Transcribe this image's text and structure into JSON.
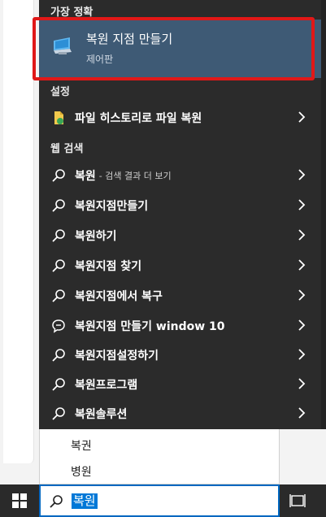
{
  "sections": {
    "best_match_header": "가장 정확",
    "settings_header": "설정",
    "web_header": "웹 검색"
  },
  "best_match": {
    "title": "복원 지점 만들기",
    "subtitle": "제어판",
    "icon": "system-restore-monitor-icon"
  },
  "settings_items": [
    {
      "label": "파일 히스토리로 파일 복원",
      "icon": "file-history-icon"
    }
  ],
  "web_items": [
    {
      "label": "복원",
      "suffix": "- 검색 결과 더 보기",
      "icon": "search-icon"
    },
    {
      "label": "복원지점만들기",
      "icon": "search-icon"
    },
    {
      "label": "복원하기",
      "icon": "search-icon"
    },
    {
      "label": "복원지점 찾기",
      "icon": "search-icon"
    },
    {
      "label": "복원지점에서 복구",
      "icon": "search-icon"
    },
    {
      "label": "복원지점 만들기 window 10",
      "icon": "chat-bubble-icon"
    },
    {
      "label": "복원지점설정하기",
      "icon": "search-icon"
    },
    {
      "label": "복원프로그램",
      "icon": "search-icon"
    },
    {
      "label": "복원솔루션",
      "icon": "search-icon"
    }
  ],
  "suggestions": [
    "복권",
    "병원"
  ],
  "search": {
    "value": "복원"
  },
  "colors": {
    "panel_bg": "#2b2b2b",
    "best_match_bg": "#3e5a75",
    "highlight": "#e01818",
    "taskbar": "#2a2a2a",
    "accent": "#0078d7"
  }
}
